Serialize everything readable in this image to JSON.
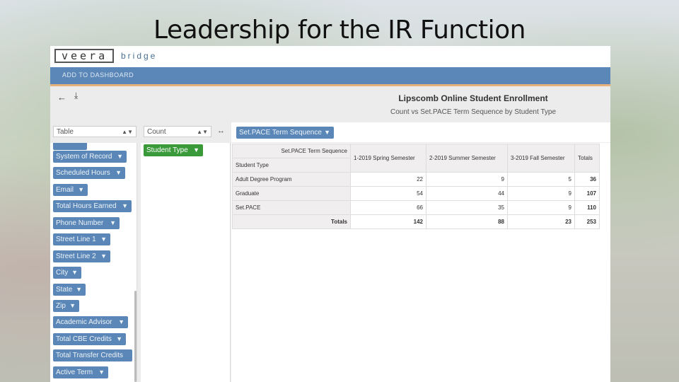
{
  "slide": {
    "title": "Leadership for the IR Function"
  },
  "brand": {
    "logo": "veera",
    "product": "bridge"
  },
  "toolbar": {
    "add_to_dashboard": "ADD TO DASHBOARD"
  },
  "icons": {
    "back": "back-arrow-icon",
    "download": "download-icon",
    "swap": "swap-icon",
    "filter": "filter-icon"
  },
  "colors": {
    "header_bar": "#5a87b7",
    "accent_line": "#e8b07a",
    "field_pill": "#5a87b7",
    "row_pill": "#3a9a3a"
  },
  "chart": {
    "title": "Lipscomb Online Student Enrollment",
    "subtitle": "Count vs Set.PACE Term Sequence by Student Type"
  },
  "controls": {
    "renderer": "Table",
    "aggregator": "Count"
  },
  "column_field": "Set.PACE Term Sequence",
  "row_field": "Student Type",
  "fields": [
    "System of Record",
    "Scheduled Hours",
    "Email",
    "Total Hours Earned",
    "Phone Number",
    "Street Line 1",
    "Street Line 2",
    "City",
    "State",
    "Zip",
    "Academic Advisor",
    "Total CBE Credits",
    "Total Transfer Credits",
    "Active Term"
  ],
  "table": {
    "col_header_label": "Set.PACE Term Sequence",
    "row_header_label": "Student Type",
    "columns": [
      "1-2019 Spring Semester",
      "2-2019 Summer Semester",
      "3-2019 Fall Semester",
      "Totals"
    ],
    "rows": [
      {
        "label": "Adult Degree Program",
        "values": [
          "22",
          "9",
          "5",
          "36"
        ]
      },
      {
        "label": "Graduate",
        "values": [
          "54",
          "44",
          "9",
          "107"
        ]
      },
      {
        "label": "Set.PACE",
        "values": [
          "66",
          "35",
          "9",
          "110"
        ]
      }
    ],
    "totals": {
      "label": "Totals",
      "values": [
        "142",
        "88",
        "23",
        "253"
      ]
    }
  }
}
